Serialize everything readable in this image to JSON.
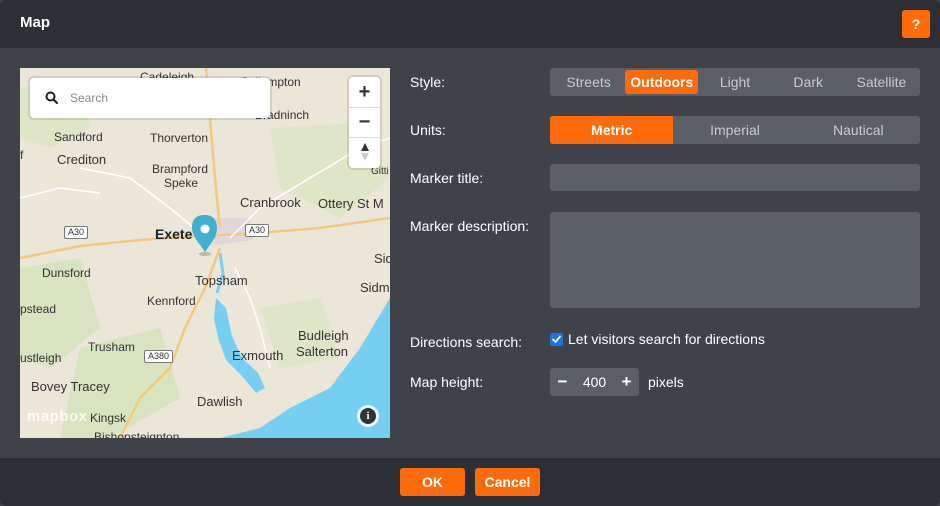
{
  "dialog": {
    "title": "Map",
    "help_label": "?"
  },
  "map": {
    "search_placeholder": "Search",
    "zoom_in": "+",
    "zoom_out": "−",
    "compass": "▲",
    "attribution_logo": "mapbox",
    "info_label": "i",
    "labels": {
      "cadeleigh": "Cadeleigh",
      "cullompton": "Cullompton",
      "bradninch": "Bradninch",
      "sandford": "Sandford",
      "thorverton": "Thorverton",
      "crediton": "Crediton",
      "brampford_speke_1": "Brampford",
      "brampford_speke_2": "Speke",
      "gitti": "Gitti",
      "cranbrook": "Cranbrook",
      "ottery": "Ottery St M",
      "exeter": "Exete",
      "sid": "Sid",
      "dunsford": "Dunsford",
      "topsham": "Topsham",
      "sidm": "Sidm",
      "kennford": "Kennford",
      "pstead": "pstead",
      "budleigh": "Budleigh",
      "salterton": "Salterton",
      "trusham": "Trusham",
      "exmouth": "Exmouth",
      "ustleigh": "ustleigh",
      "bovey_tracey": "Bovey Tracey",
      "dawlish": "Dawlish",
      "kingskerswell": "Kingsk",
      "bishopsteignton": "Bishopsteignton",
      "f": "f"
    },
    "roads": {
      "a30_west": "A30",
      "a30_east": "A30",
      "a380": "A380"
    }
  },
  "form": {
    "style": {
      "label": "Style:",
      "options": [
        "Streets",
        "Outdoors",
        "Light",
        "Dark",
        "Satellite"
      ],
      "selected": "Outdoors"
    },
    "units": {
      "label": "Units:",
      "options": [
        "Metric",
        "Imperial",
        "Nautical"
      ],
      "selected": "Metric"
    },
    "marker_title": {
      "label": "Marker title:",
      "value": ""
    },
    "marker_description": {
      "label": "Marker description:",
      "value": ""
    },
    "directions_search": {
      "label": "Directions search:",
      "checkbox_label": "Let visitors search for directions",
      "checked": true
    },
    "map_height": {
      "label": "Map height:",
      "minus": "−",
      "value": "400",
      "plus": "+",
      "unit": "pixels"
    }
  },
  "footer": {
    "ok_label": "OK",
    "cancel_label": "Cancel"
  },
  "colors": {
    "accent": "#ff6b0b",
    "titlebar": "#2c2f34",
    "panel": "#3f4349",
    "control": "#5a5f66",
    "water": "#75cff0",
    "marker": "#3fb1ce"
  }
}
